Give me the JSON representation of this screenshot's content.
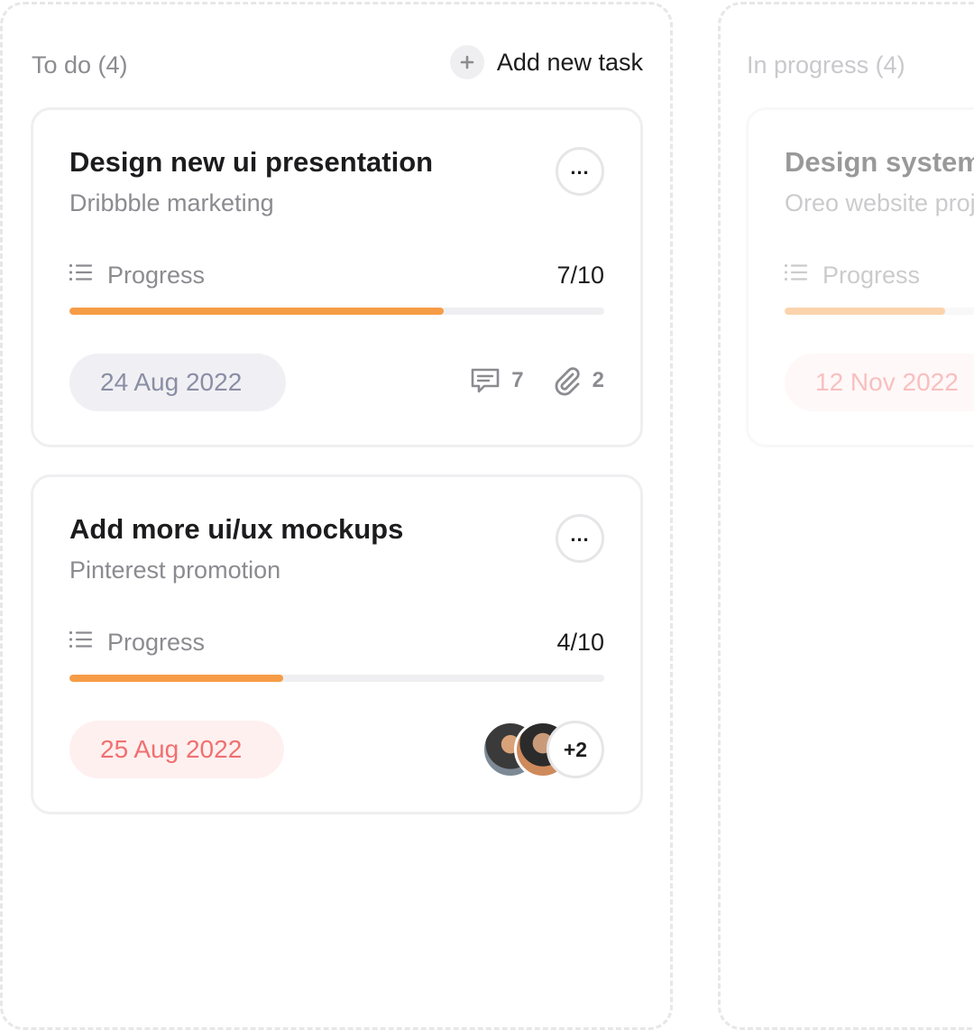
{
  "columns": [
    {
      "title": "To do (4)",
      "add_label": "Add new task",
      "cards": [
        {
          "title": "Design new ui presentation",
          "subtitle": "Dribbble marketing",
          "progress_label": "Progress",
          "progress_count": "7/10",
          "progress_fraction": 0.7,
          "date": "24 Aug 2022",
          "comments": "7",
          "attachments": "2"
        },
        {
          "title": "Add more ui/ux mockups",
          "subtitle": "Pinterest promotion",
          "progress_label": "Progress",
          "progress_count": "4/10",
          "progress_fraction": 0.4,
          "date": "25 Aug 2022",
          "extra_members": "+2"
        }
      ]
    },
    {
      "title": "In progress (4)",
      "cards": [
        {
          "title": "Design system",
          "subtitle": "Oreo website project",
          "progress_label": "Progress",
          "date": "12 Nov 2022",
          "progress_fraction": 0.3
        }
      ]
    }
  ],
  "colors": {
    "accent": "#f79c46",
    "date_neutral": "#8a8ea5",
    "date_overdue": "#f07070"
  },
  "icons": {
    "add": "plus-icon",
    "more": "more-dots-icon",
    "progress": "list-icon",
    "comments": "comment-icon",
    "attachments": "paperclip-icon"
  }
}
